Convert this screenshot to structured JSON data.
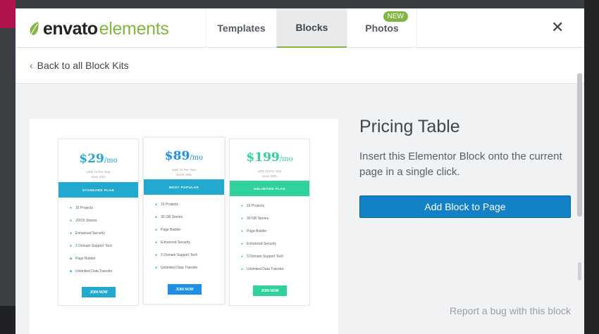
{
  "logo": {
    "word1": "envato",
    "word2": "elements"
  },
  "tabs": [
    {
      "label": "Templates"
    },
    {
      "label": "Blocks"
    },
    {
      "label": "Photos",
      "badge": "NEW"
    }
  ],
  "active_tab": "Blocks",
  "close_icon": "✕",
  "back_link": {
    "label": "Back to all Block Kits"
  },
  "preview": {
    "plans": [
      {
        "currency": "$",
        "amount": "29",
        "per": "/mo",
        "sub1": "USD 72 Per Year",
        "sub2": "Save 33%",
        "band": "STANDARD PLAN",
        "features": [
          "15 Projects",
          "JOOX Stories",
          "Enhanced Security",
          "3 Domain Support Tech",
          "Page Builder",
          "Unlimited Data Transfer"
        ],
        "join": "JOIN NOW",
        "color": "#21a9cf"
      },
      {
        "currency": "$",
        "amount": "89",
        "per": "/mo",
        "sub1": "USD 72 Per Year",
        "sub2": "SAVE 33%",
        "band": "MOST POPULAR",
        "features": [
          "15 Projects",
          "30 GB Stories",
          "Page Builder",
          "Enhanced Security",
          "3 Domain Support Tech",
          "Unlimited Data Transfer"
        ],
        "join": "JOIN NOW",
        "color": "#1d8fe6"
      },
      {
        "currency": "$",
        "amount": "199",
        "per": "/mo",
        "sub1": "USD 72 Per Year",
        "sub2": "Save 33%",
        "band": "UNLIMITED PLAN",
        "features": [
          "15 Projects",
          "30 GB Stories",
          "Page Builder",
          "Enhanced Security",
          "3 Domain Support Tech",
          "Unlimited Data Transfer"
        ],
        "join": "JOIN NOW",
        "color": "#2fd29a"
      }
    ]
  },
  "detail": {
    "title": "Pricing Table",
    "description": "Insert this Elementor Block onto the current page in a single click.",
    "add_button": "Add Block to Page",
    "report_link": "Report a bug with this block"
  },
  "colors": {
    "accent_green": "#82b541",
    "button_blue": "#1381c5"
  }
}
